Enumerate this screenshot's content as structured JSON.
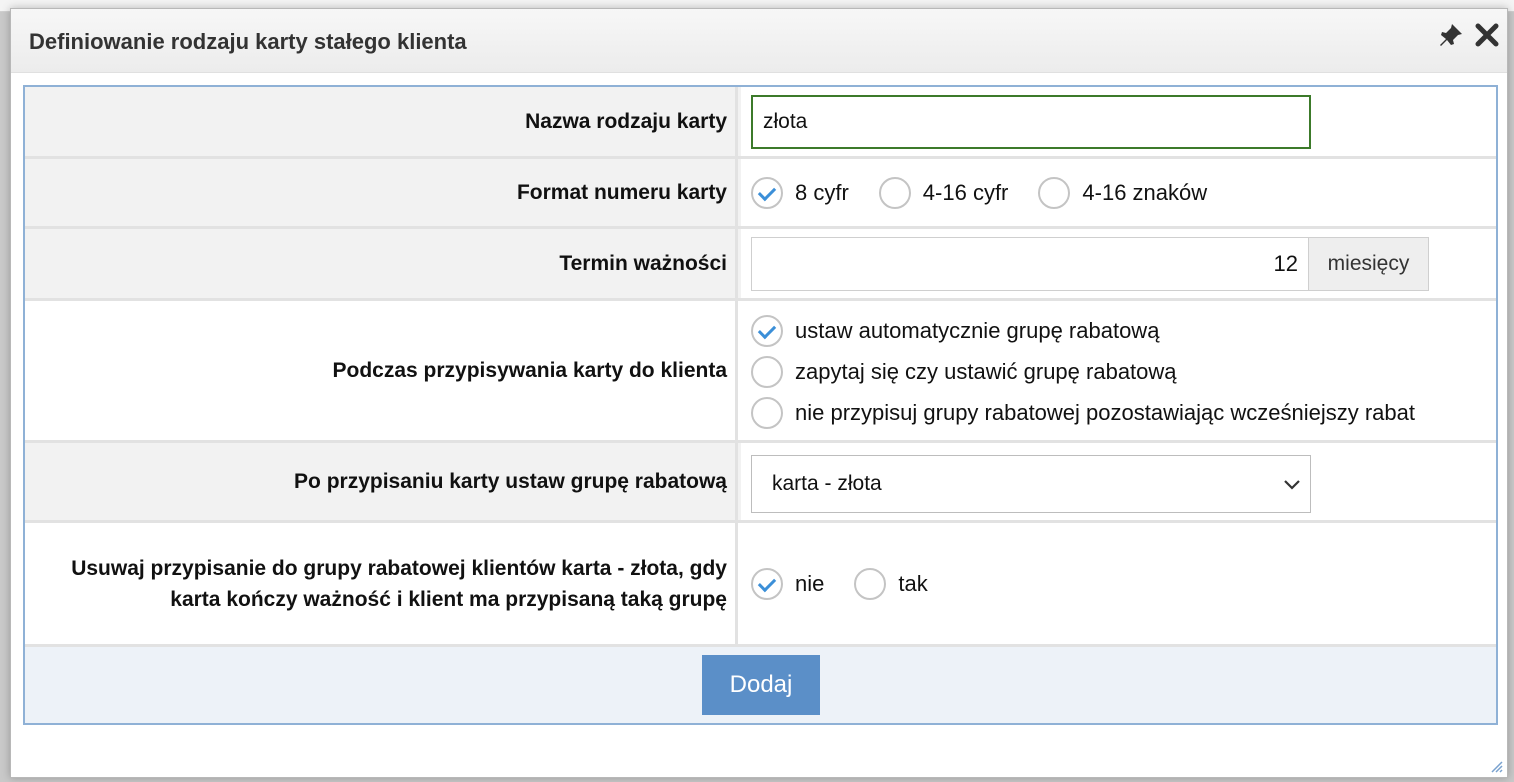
{
  "dialog": {
    "title": "Definiowanie rodzaju karty stałego klienta",
    "pin_icon": "pin-icon",
    "close_icon": "close-icon"
  },
  "fields": {
    "card_name": {
      "label": "Nazwa rodzaju karty",
      "value": "złota"
    },
    "card_format": {
      "label": "Format numeru karty",
      "options": [
        "8 cyfr",
        "4-16 cyfr",
        "4-16 znaków"
      ],
      "selected": 0
    },
    "validity": {
      "label": "Termin ważności",
      "value": "12",
      "unit": "miesięcy"
    },
    "on_assign": {
      "label": "Podczas przypisywania karty do klienta",
      "options": [
        "ustaw automatycznie grupę rabatową",
        "zapytaj się czy ustawić grupę rabatową",
        "nie przypisuj grupy rabatowej pozostawiając wcześniejszy rabat"
      ],
      "selected": 0
    },
    "discount_group": {
      "label": "Po przypisaniu karty ustaw grupę rabatową",
      "selected_value": "karta - złota"
    },
    "remove_assignment": {
      "label": "Usuwaj przypisanie do grupy rabatowej klientów karta - złota, gdy karta kończy ważność i klient ma przypisaną taką grupę",
      "options": [
        "nie",
        "tak"
      ],
      "selected": 0
    }
  },
  "footer": {
    "submit_label": "Dodaj"
  },
  "colors": {
    "accent": "#5b8fc8",
    "check": "#3b8fd8",
    "input_focus": "#3c7a2a",
    "frame": "#8fb1d6"
  }
}
